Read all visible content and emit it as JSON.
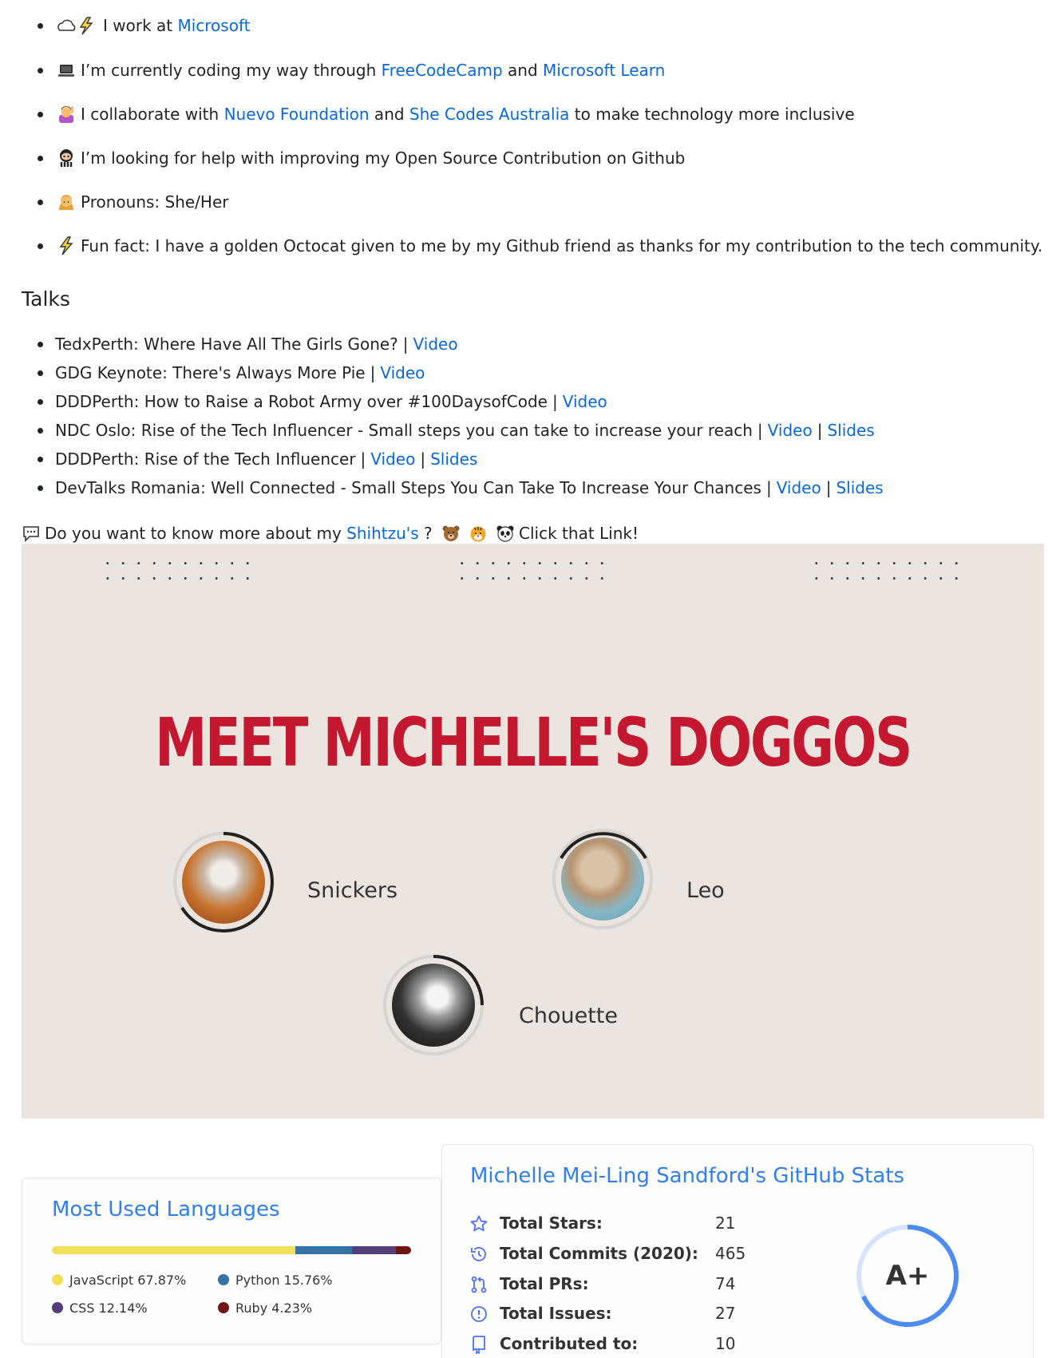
{
  "intro": [
    {
      "icon": "cloud-lightning-icon",
      "text": "I work at ",
      "links": [
        "Microsoft"
      ]
    },
    {
      "icon": "laptop-icon",
      "text": "I’m currently coding my way through ",
      "links": [
        "FreeCodeCamp",
        "Microsoft Learn"
      ],
      "joiner": " and "
    },
    {
      "icon": "woman-raising-hand-icon",
      "text": "I collaborate with ",
      "links": [
        "Nuevo Foundation",
        "She Codes Australia"
      ],
      "joiner": " and ",
      "suffix": " to make technology more inclusive"
    },
    {
      "icon": "octocat-icon",
      "text": "I’m looking for help with improving my Open Source Contribution on Github"
    },
    {
      "icon": "woman-icon",
      "text": "Pronouns: She/Her"
    },
    {
      "icon": "lightning-icon",
      "text": "Fun fact: I have a golden Octocat given to me by my Github friend as thanks for my contribution to the tech community."
    }
  ],
  "talks": {
    "heading": "Talks",
    "items": [
      {
        "title": "TedxPerth: Where Have All The Girls Gone?",
        "video": "Video"
      },
      {
        "title": "GDG Keynote: There's Always More Pie",
        "video": "Video"
      },
      {
        "title": "DDDPerth: How to Raise a Robot Army over #100DaysofCode",
        "video": "Video"
      },
      {
        "title": "NDC Oslo: Rise of the Tech Influencer - Small steps you can take to increase your reach",
        "video": "Video",
        "slides": "Slides"
      },
      {
        "title": "DDDPerth: Rise of the Tech Influencer",
        "video": "Video",
        "slides": "Slides"
      },
      {
        "title": "DevTalks Romania: Well Connected - Small Steps You Can Take To Increase Your Chances",
        "video": "Video",
        "slides": "Slides"
      }
    ],
    "separator": "|"
  },
  "dogs_line": {
    "prefix": "Do you want to know more about my ",
    "link": "Shihtzu's",
    "question": " ?",
    "suffix": "Click that Link!"
  },
  "banner": {
    "title": "MEET MICHELLE'S DOGGOS",
    "dogs": [
      {
        "name": "Snickers"
      },
      {
        "name": "Leo"
      },
      {
        "name": "Chouette"
      }
    ]
  },
  "languages": {
    "title": "Most Used Languages",
    "items": [
      {
        "name": "JavaScript",
        "percent": 67.87,
        "label": "JavaScript 67.87%",
        "color": "#f1e05a"
      },
      {
        "name": "Python",
        "percent": 15.76,
        "label": "Python 15.76%",
        "color": "#3572a5"
      },
      {
        "name": "CSS",
        "percent": 12.14,
        "label": "CSS 12.14%",
        "color": "#563d7c"
      },
      {
        "name": "Ruby",
        "percent": 4.23,
        "label": "Ruby 4.23%",
        "color": "#701516"
      }
    ]
  },
  "stats": {
    "title": "Michelle Mei-Ling Sandford's GitHub Stats",
    "rows": [
      {
        "icon": "star-icon",
        "label": "Total Stars:",
        "value": "21"
      },
      {
        "icon": "history-icon",
        "label": "Total Commits (2020):",
        "value": "465"
      },
      {
        "icon": "pull-request-icon",
        "label": "Total PRs:",
        "value": "74"
      },
      {
        "icon": "issue-icon",
        "label": "Total Issues:",
        "value": "27"
      },
      {
        "icon": "repo-icon",
        "label": "Contributed to:",
        "value": "10"
      }
    ],
    "grade": "A+",
    "grade_progress": 0.68
  },
  "colors": {
    "link": "#0969da",
    "accent": "#2f80ed",
    "banner_title": "#c3182f",
    "banner_bg": "#ece4de"
  }
}
